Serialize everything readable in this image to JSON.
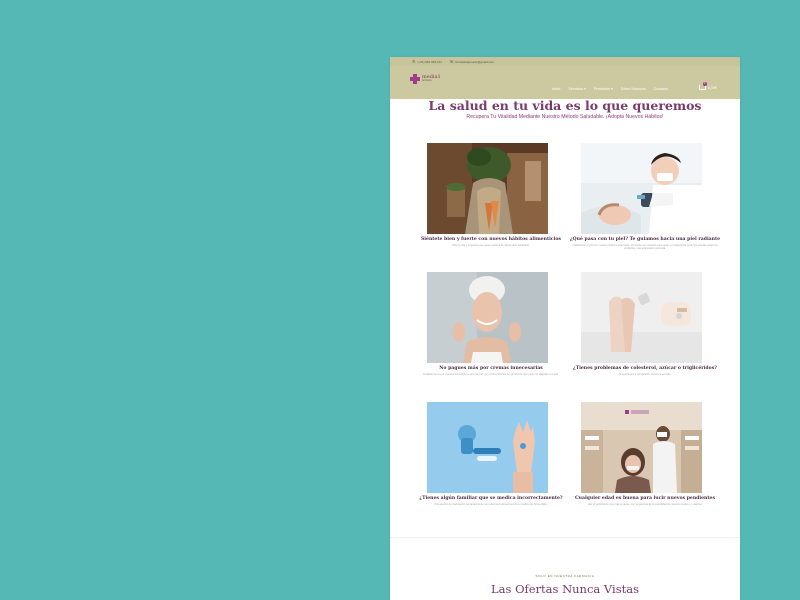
{
  "topbar": {
    "phone": "(+34) 981 933 101",
    "email": "farmaciaejemplo@gmail.com"
  },
  "header": {
    "logo_name": "media1",
    "logo_sub": "farmacia",
    "nav": [
      "Inicio",
      "Servicios ▾",
      "Productos ▾",
      "Sobre Nosotros",
      "Contacto"
    ],
    "cart_label": "0,00€",
    "cart_count": "0"
  },
  "hero": {
    "title": "La salud en tu vida es lo que queremos",
    "subtitle": "Recupera Tu Vitalidad Mediante Nuestro Método Saludable. ¡Adopta Nuevos Hábitos!"
  },
  "cards": [
    {
      "image": "woman-with-vegetables-photo",
      "title": "Siéntete bien y fuerte con nuevos hábitos alimenticios",
      "desc": "Pide tu cita y empieza una nueva manera de alimentarte saludable."
    },
    {
      "image": "facial-treatment-photo",
      "title": "¿Qué pasa con tu piel? Te guiamos hacia una piel radiante",
      "desc": "Analizamos tu piel con nuestro sistema avanzado. Consulta con nosotros para tener un tratamiento para que puedas elegir los productos más adecuados para ella."
    },
    {
      "image": "smiling-woman-cream-photo",
      "title": "No pagues más por cremas innecesarias",
      "desc": "Analizamos con la máxima tecnología tu tipo de piel y te recomendamos los productos que mejor se adaptan a tu piel."
    },
    {
      "image": "glucose-test-photo",
      "title": "¿Tienes problemas de colesterol, azúcar o triglicéridos?",
      "desc": "Te ayudamos a controlarlos de forma sencilla."
    },
    {
      "image": "medication-hand-photo",
      "title": "¿Tienes algún familiar que se medica incorrectamente?",
      "desc": "Preparamos la medicación semanalmente con todas las indicaciones de tu médico de forma clara."
    },
    {
      "image": "ear-piercing-photo",
      "title": "Cualquier edad es buena para lucir nuevos pendientes",
      "desc": "Haz el perforación que más te guste, con la garantía de la esterilidad de nuestro espacio y material."
    }
  ],
  "offers": {
    "kicker": "SOLO EN NUESTRA FARMACIA",
    "title": "Las Ofertas Nunca Vistas"
  },
  "colors": {
    "background": "#55b8b5",
    "header": "#ccc8a0",
    "accent": "#7a3a6c"
  }
}
